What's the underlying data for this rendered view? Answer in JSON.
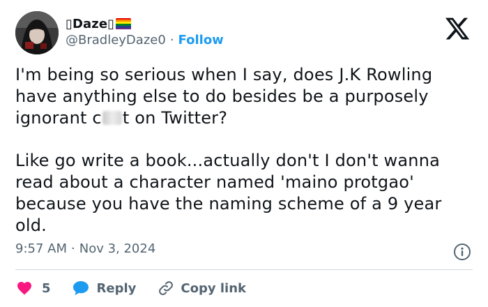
{
  "author": {
    "display_name": "▯Daze▯",
    "handle": "@BradleyDaze0",
    "separator": "·",
    "follow_label": "Follow",
    "flag_colors": [
      "#e40303",
      "#ff8c00",
      "#ffed00",
      "#008026",
      "#24408e",
      "#732982"
    ]
  },
  "tweet": {
    "paragraph_1_before": "I'm being so serious when I say, does J.K Rowling have anything else to do besides be a purposely ignorant c",
    "paragraph_1_after": "t on Twitter?",
    "paragraph_2": "Like go write a book...actually don't I don't wanna read about a character named 'maino protgao' because you have the naming scheme of a 9 year old."
  },
  "meta": {
    "time": "9:57 AM",
    "separator": "·",
    "date": "Nov 3, 2024"
  },
  "actions": {
    "like_count": "5",
    "reply_label": "Reply",
    "copy_link_label": "Copy link"
  },
  "colors": {
    "accent": "#1d9bf0",
    "like": "#f91880",
    "secondary_text": "#536471",
    "divider": "#cfd9de"
  },
  "icons": {
    "brand": "x-logo-icon",
    "info": "info-icon",
    "like": "heart-icon",
    "reply": "speech-bubble-icon",
    "copy_link": "link-icon"
  }
}
